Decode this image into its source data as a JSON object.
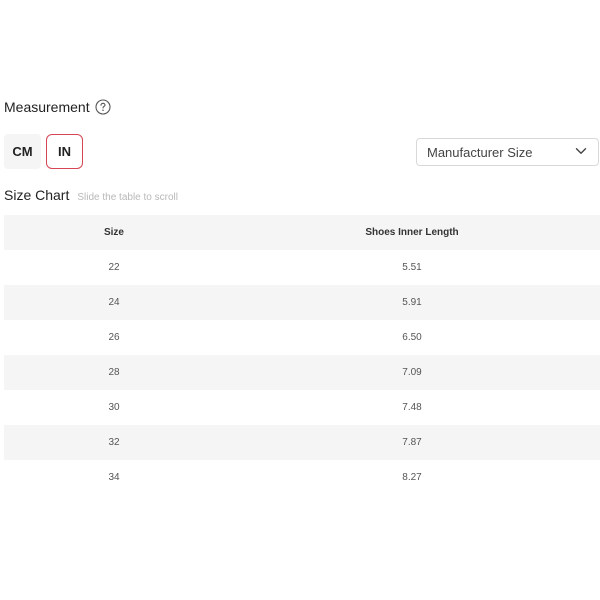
{
  "measurement": {
    "title": "Measurement",
    "units": [
      "CM",
      "IN"
    ],
    "selected_unit": "IN"
  },
  "size_select": {
    "value": "Manufacturer Size"
  },
  "size_chart": {
    "title": "Size Chart",
    "hint": "Slide the table to scroll",
    "columns": [
      "Size",
      "Shoes Inner Length"
    ],
    "rows": [
      [
        "22",
        "5.51"
      ],
      [
        "24",
        "5.91"
      ],
      [
        "26",
        "6.50"
      ],
      [
        "28",
        "7.09"
      ],
      [
        "30",
        "7.48"
      ],
      [
        "32",
        "7.87"
      ],
      [
        "34",
        "8.27"
      ]
    ]
  },
  "colors": {
    "accent": "#d64553",
    "stripe": "#f5f5f5"
  },
  "icons": {
    "help": "question-circle-icon",
    "dropdown": "chevron-down-icon"
  }
}
